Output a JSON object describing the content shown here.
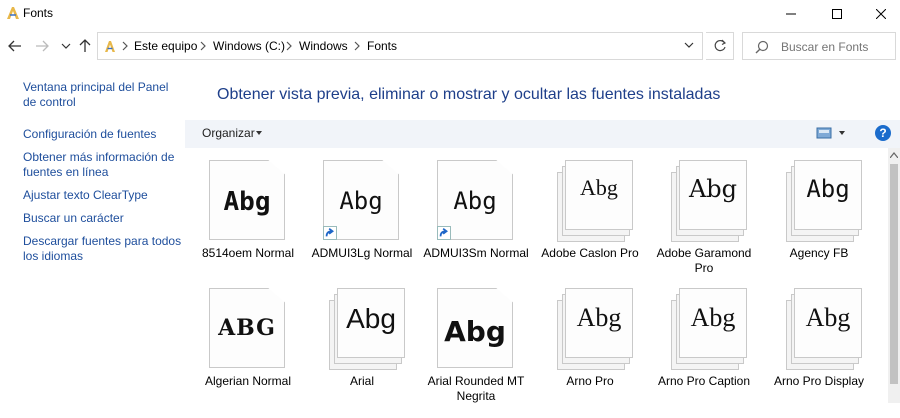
{
  "window": {
    "title": "Fonts"
  },
  "address": {
    "crumbs": [
      "Este equipo",
      "Windows (C:)",
      "Windows",
      "Fonts"
    ]
  },
  "search": {
    "placeholder": "Buscar en Fonts"
  },
  "sidebar": {
    "links": [
      "Ventana principal del Panel de control",
      "Configuración de fuentes",
      "Obtener más información de fuentes en línea",
      "Ajustar texto ClearType",
      "Buscar un carácter",
      "Descargar fuentes para todos los idiomas"
    ]
  },
  "main": {
    "heading": "Obtener vista previa, eliminar o mostrar y ocultar las fuentes instaladas",
    "toolbar": {
      "organize": "Organizar",
      "help": "?"
    }
  },
  "fonts": [
    {
      "name": "8514oem Normal",
      "sample": "Abg",
      "style": "single",
      "shortcut": false
    },
    {
      "name": "ADMUI3Lg Normal",
      "sample": "Abg",
      "style": "single",
      "shortcut": true
    },
    {
      "name": "ADMUI3Sm Normal",
      "sample": "Abg",
      "style": "single",
      "shortcut": true
    },
    {
      "name": "Adobe Caslon Pro",
      "sample": "Abg",
      "style": "stack",
      "shortcut": false
    },
    {
      "name": "Adobe Garamond Pro",
      "sample": "Abg",
      "style": "stack",
      "shortcut": false
    },
    {
      "name": "Agency FB",
      "sample": "Abg",
      "style": "stack",
      "shortcut": false
    },
    {
      "name": "Algerian Normal",
      "sample": "ABG",
      "style": "single",
      "shortcut": false
    },
    {
      "name": "Arial",
      "sample": "Abg",
      "style": "stack",
      "shortcut": false
    },
    {
      "name": "Arial Rounded MT Negrita",
      "sample": "Abg",
      "style": "single",
      "shortcut": false
    },
    {
      "name": "Arno Pro",
      "sample": "Abg",
      "style": "stack",
      "shortcut": false
    },
    {
      "name": "Arno Pro Caption",
      "sample": "Abg",
      "style": "stack",
      "shortcut": false
    },
    {
      "name": "Arno Pro Display",
      "sample": "Abg",
      "style": "stack",
      "shortcut": false
    }
  ],
  "colors": {
    "link": "#1e4e9c",
    "heading": "#1e3f8a",
    "toolbar": "#f1f4f9",
    "help": "#1b6ccc"
  }
}
